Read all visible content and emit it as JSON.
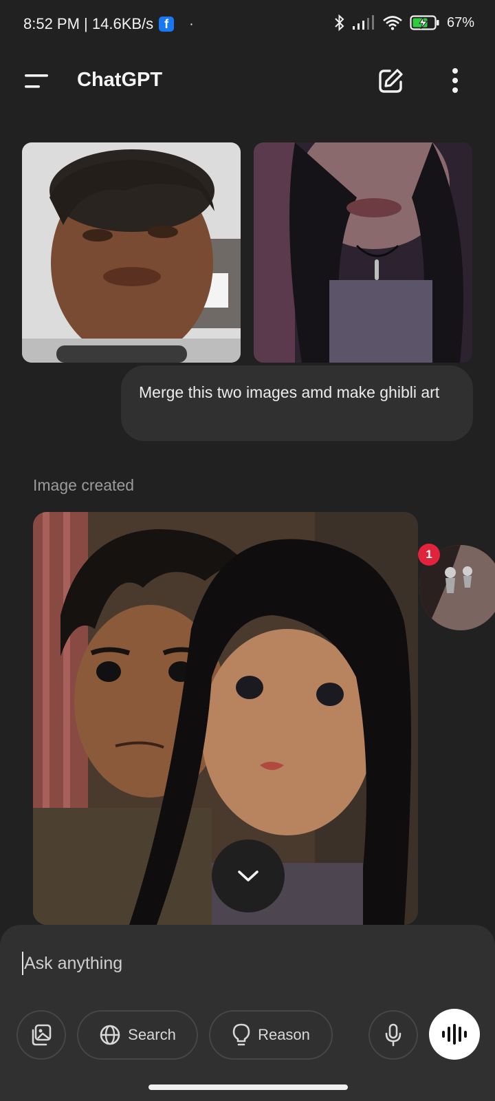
{
  "status_bar": {
    "time_speed": "8:52 PM | 14.6KB/s",
    "fb_icon_letter": "f",
    "dot": "·",
    "battery": "67%"
  },
  "header": {
    "title": "ChatGPT",
    "icons": [
      "menu-icon",
      "edit-icon",
      "more-vertical-icon"
    ]
  },
  "conversation": {
    "user_message": "Merge this two images amd make ghibli art",
    "assistant_status": "Image created"
  },
  "chat_head": {
    "badge_count": "1"
  },
  "composer": {
    "placeholder": "Ask anything",
    "buttons": {
      "search": "Search",
      "reason": "Reason"
    }
  },
  "colors": {
    "background": "#212121",
    "surface": "#303030",
    "badge": "#e0243b",
    "facebook": "#1877f2"
  }
}
